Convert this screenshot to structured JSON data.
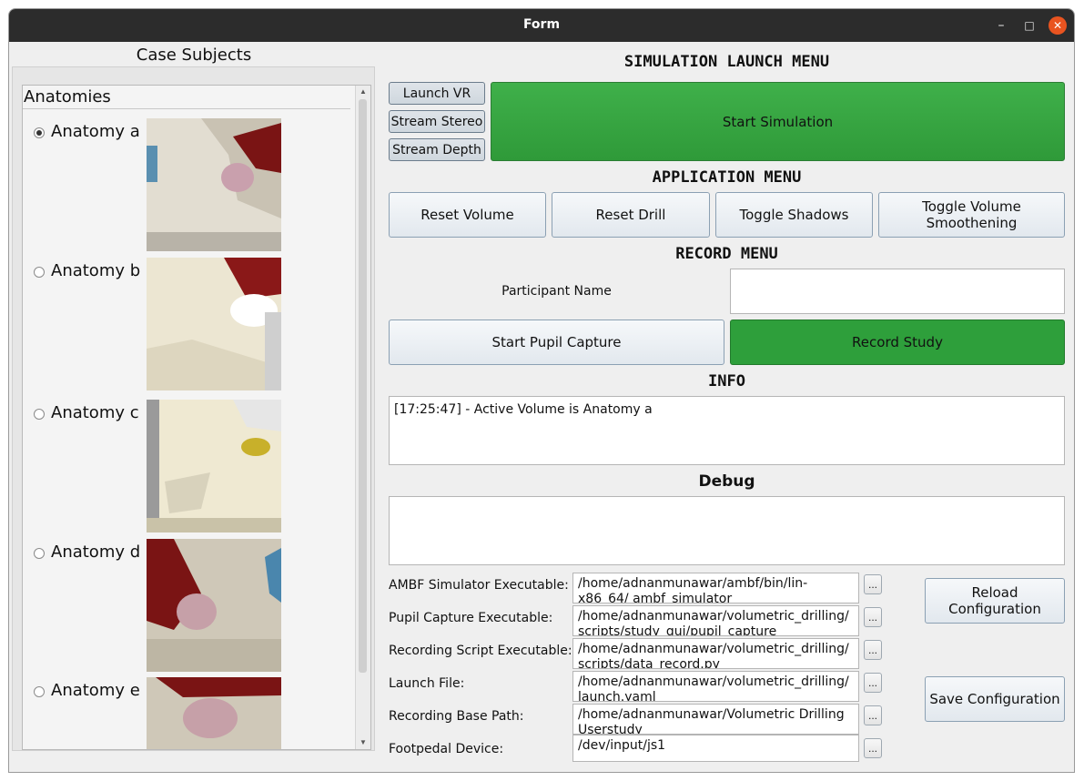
{
  "window": {
    "title": "Form",
    "controls": {
      "minimize": "–",
      "maximize": "□",
      "close": "✕"
    }
  },
  "left": {
    "heading": "Case Subjects (Anatomies)",
    "list_header": "Anatomies",
    "anatomies": [
      {
        "label": "Anatomy a",
        "selected": true
      },
      {
        "label": "Anatomy b",
        "selected": false
      },
      {
        "label": "Anatomy c",
        "selected": false
      },
      {
        "label": "Anatomy d",
        "selected": false
      },
      {
        "label": "Anatomy e",
        "selected": false
      }
    ]
  },
  "sim": {
    "heading": "SIMULATION LAUNCH MENU",
    "launch_vr": "Launch VR",
    "stream_stereo": "Stream Stereo",
    "stream_depth": "Stream Depth",
    "start_simulation": "Start Simulation"
  },
  "app": {
    "heading": "APPLICATION MENU",
    "reset_volume": "Reset Volume",
    "reset_drill": "Reset Drill",
    "toggle_shadows": "Toggle Shadows",
    "toggle_smoothening": "Toggle Volume Smoothening"
  },
  "record": {
    "heading": "RECORD MENU",
    "participant_label": "Participant Name",
    "participant_value": "",
    "start_pupil": "Start Pupil Capture",
    "record_study": "Record Study"
  },
  "info": {
    "heading": "INFO",
    "text": "[17:25:47] - Active Volume is Anatomy a"
  },
  "debug": {
    "heading": "Debug",
    "text": ""
  },
  "config": {
    "browse": "...",
    "rows": [
      {
        "label": "AMBF Simulator Executable:",
        "value": "/home/adnanmunawar/ambf/bin/lin-x86_64/ ambf_simulator"
      },
      {
        "label": "Pupil Capture Executable:",
        "value": "/home/adnanmunawar/volumetric_drilling/ scripts/study_gui/pupil_capture"
      },
      {
        "label": "Recording Script Executable:",
        "value": "/home/adnanmunawar/volumetric_drilling/ scripts/data_record.py"
      },
      {
        "label": "Launch File:",
        "value": "/home/adnanmunawar/volumetric_drilling/ launch.yaml"
      },
      {
        "label": "Recording Base Path:",
        "value": "/home/adnanmunawar/Volumetric Drilling Userstudy"
      },
      {
        "label": "Footpedal Device:",
        "value": "/dev/input/js1"
      }
    ],
    "reload": "Reload Configuration",
    "save": "Save Configuration"
  },
  "colors": {
    "green": "#2e9f3b",
    "titlebar": "#2c2c2c",
    "close": "#e95420"
  }
}
